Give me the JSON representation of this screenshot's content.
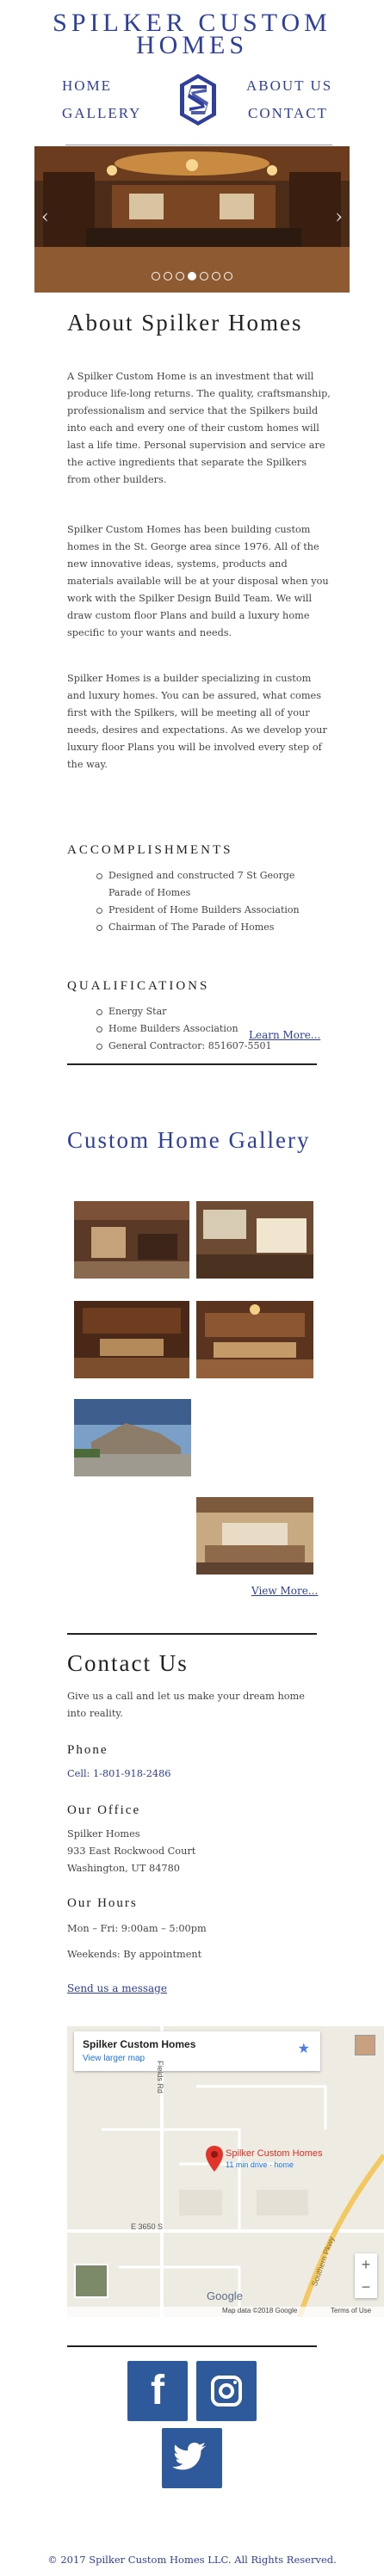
{
  "site": {
    "title_line1": "SPILKER CUSTOM",
    "title_line2": "HOMES"
  },
  "nav": {
    "home": "HOME",
    "gallery": "GALLERY",
    "about": "ABOUT US",
    "contact": "CONTACT"
  },
  "slider": {
    "dots": 7,
    "active_dot": 4
  },
  "about": {
    "heading": "About Spilker Homes",
    "p1": "A Spilker Custom Home is an investment that will produce life-long returns. The quality, craftsmanship, professionalism and service that the Spilkers build into each and every one of their custom homes will last a life time. Personal supervision and service are the active ingredients that separate the Spilkers from other builders.",
    "p2": "Spilker Custom Homes has been building custom homes in the St. George area since 1976. All of the new innovative ideas, systems, products and materials available will be at your disposal when you work with the Spilker Design Build Team. We will draw custom floor Plans and build a luxury home specific to your wants and needs.",
    "p3": "Spilker Homes is a builder specializing in custom and luxury homes. You can be assured, what comes first with the Spilkers, will be meeting all of your needs, desires and expectations. As we develop your luxury floor Plans you will be involved every step of the way."
  },
  "accomplishments": {
    "heading": "ACCOMPLISHMENTS",
    "items": [
      "Designed and constructed 7 St George Parade of Homes",
      "President of Home Builders Association",
      "Chairman of The Parade of Homes"
    ]
  },
  "qualifications": {
    "heading": "QUALIFICATIONS",
    "items": [
      "Energy Star",
      "Home Builders Association",
      "General Contractor: 851607-5501"
    ]
  },
  "learn_more": "Learn More...",
  "gallery": {
    "heading": "Custom Home Gallery",
    "view_more": "View More..."
  },
  "contact": {
    "heading": "Contact Us",
    "intro": "Give us a call and let us make your dream home into reality.",
    "phone_heading": "Phone",
    "phone": "Cell: 1-801-918-2486",
    "office_heading": "Our Office",
    "office_name": "Spilker Homes",
    "office_street": "933 East Rockwood Court",
    "office_city": "Washington, UT 84780",
    "hours_heading": "Our Hours",
    "hours": "Mon – Fri: 9:00am – 5:00pm",
    "weekends": "Weekends: By appointment",
    "send_message": "Send us a message"
  },
  "map": {
    "place_name": "Spilker Custom Homes",
    "larger_map": "View larger map",
    "pin_label": "Spilker Custom Homes",
    "pin_sub": "11 min drive · home",
    "street1": "E 3650 S",
    "street2": "Fields Rd",
    "street3": "Southern Pkwy",
    "google": "Google",
    "map_data": "Map data ©2018 Google",
    "terms": "Terms of Use",
    "zoom_in": "+",
    "zoom_out": "−"
  },
  "social": {
    "facebook": "f",
    "instagram_alt": "instagram",
    "twitter_alt": "twitter"
  },
  "footer": "© 2017 Spilker Custom Homes LLC. All Rights Reserved."
}
